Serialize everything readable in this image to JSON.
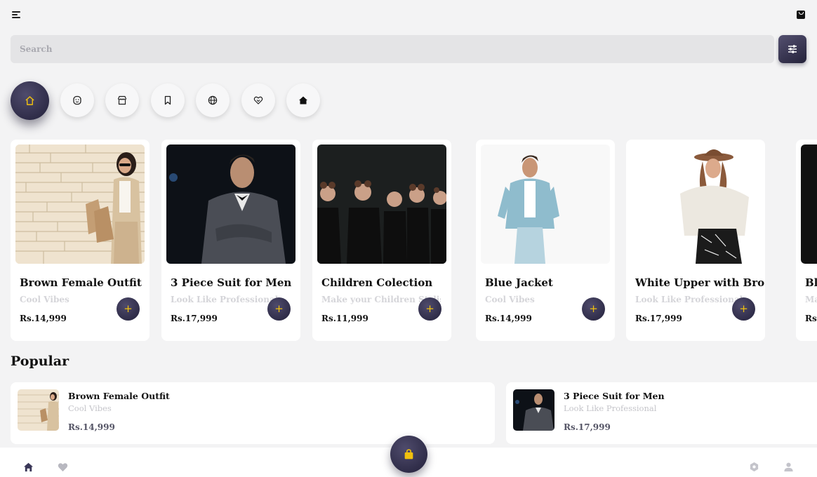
{
  "header": {
    "menu_icon": "hamburger-menu-icon",
    "bag_icon": "shopping-bag-icon"
  },
  "search": {
    "placeholder": "Search",
    "value": "",
    "filter_icon": "sliders-icon"
  },
  "categories": [
    {
      "icon": "home-icon",
      "active": true
    },
    {
      "icon": "smile-face-icon",
      "active": false
    },
    {
      "icon": "store-icon",
      "active": false
    },
    {
      "icon": "bookmark-icon",
      "active": false
    },
    {
      "icon": "globe-icon",
      "active": false
    },
    {
      "icon": "heart-handshake-icon",
      "active": false
    },
    {
      "icon": "home-filled-icon",
      "active": false
    }
  ],
  "products": [
    {
      "name": "Brown Female Outfit",
      "subtitle": "Cool Vibes",
      "price": "Rs.14,999",
      "add_label": "+"
    },
    {
      "name": "3 Piece Suit for Men",
      "subtitle": "Look Like Professional",
      "price": "Rs.17,999",
      "add_label": "+"
    },
    {
      "name": "Children Colection",
      "subtitle": "Make your Children Stylish",
      "price": "Rs.11,999",
      "add_label": "+"
    },
    {
      "name": "Blue Jacket",
      "subtitle": "Cool Vibes",
      "price": "Rs.14,999",
      "add_label": "+"
    },
    {
      "name": "White Upper with Brown Hat",
      "subtitle": "Look Like Professional",
      "price": "Rs.17,999",
      "add_label": "+"
    },
    {
      "name": "Bla",
      "subtitle": "Ma",
      "price": "Rs.",
      "add_label": "+"
    }
  ],
  "popular": {
    "title": "Popular",
    "items": [
      {
        "name": "Brown Female Outfit",
        "subtitle": "Cool Vibes",
        "price": "Rs.14,999"
      },
      {
        "name": "3 Piece Suit for Men",
        "subtitle": "Look Like Professional",
        "price": "Rs.17,999"
      }
    ]
  },
  "bottom_nav": {
    "items": [
      "home-icon",
      "heart-icon",
      "settings-icon",
      "user-icon"
    ],
    "cart_icon": "shopping-bag-icon"
  },
  "colors": {
    "accent_dark": "#2e2b45",
    "accent_yellow": "#f1c10e",
    "background": "#f3f3f4"
  }
}
